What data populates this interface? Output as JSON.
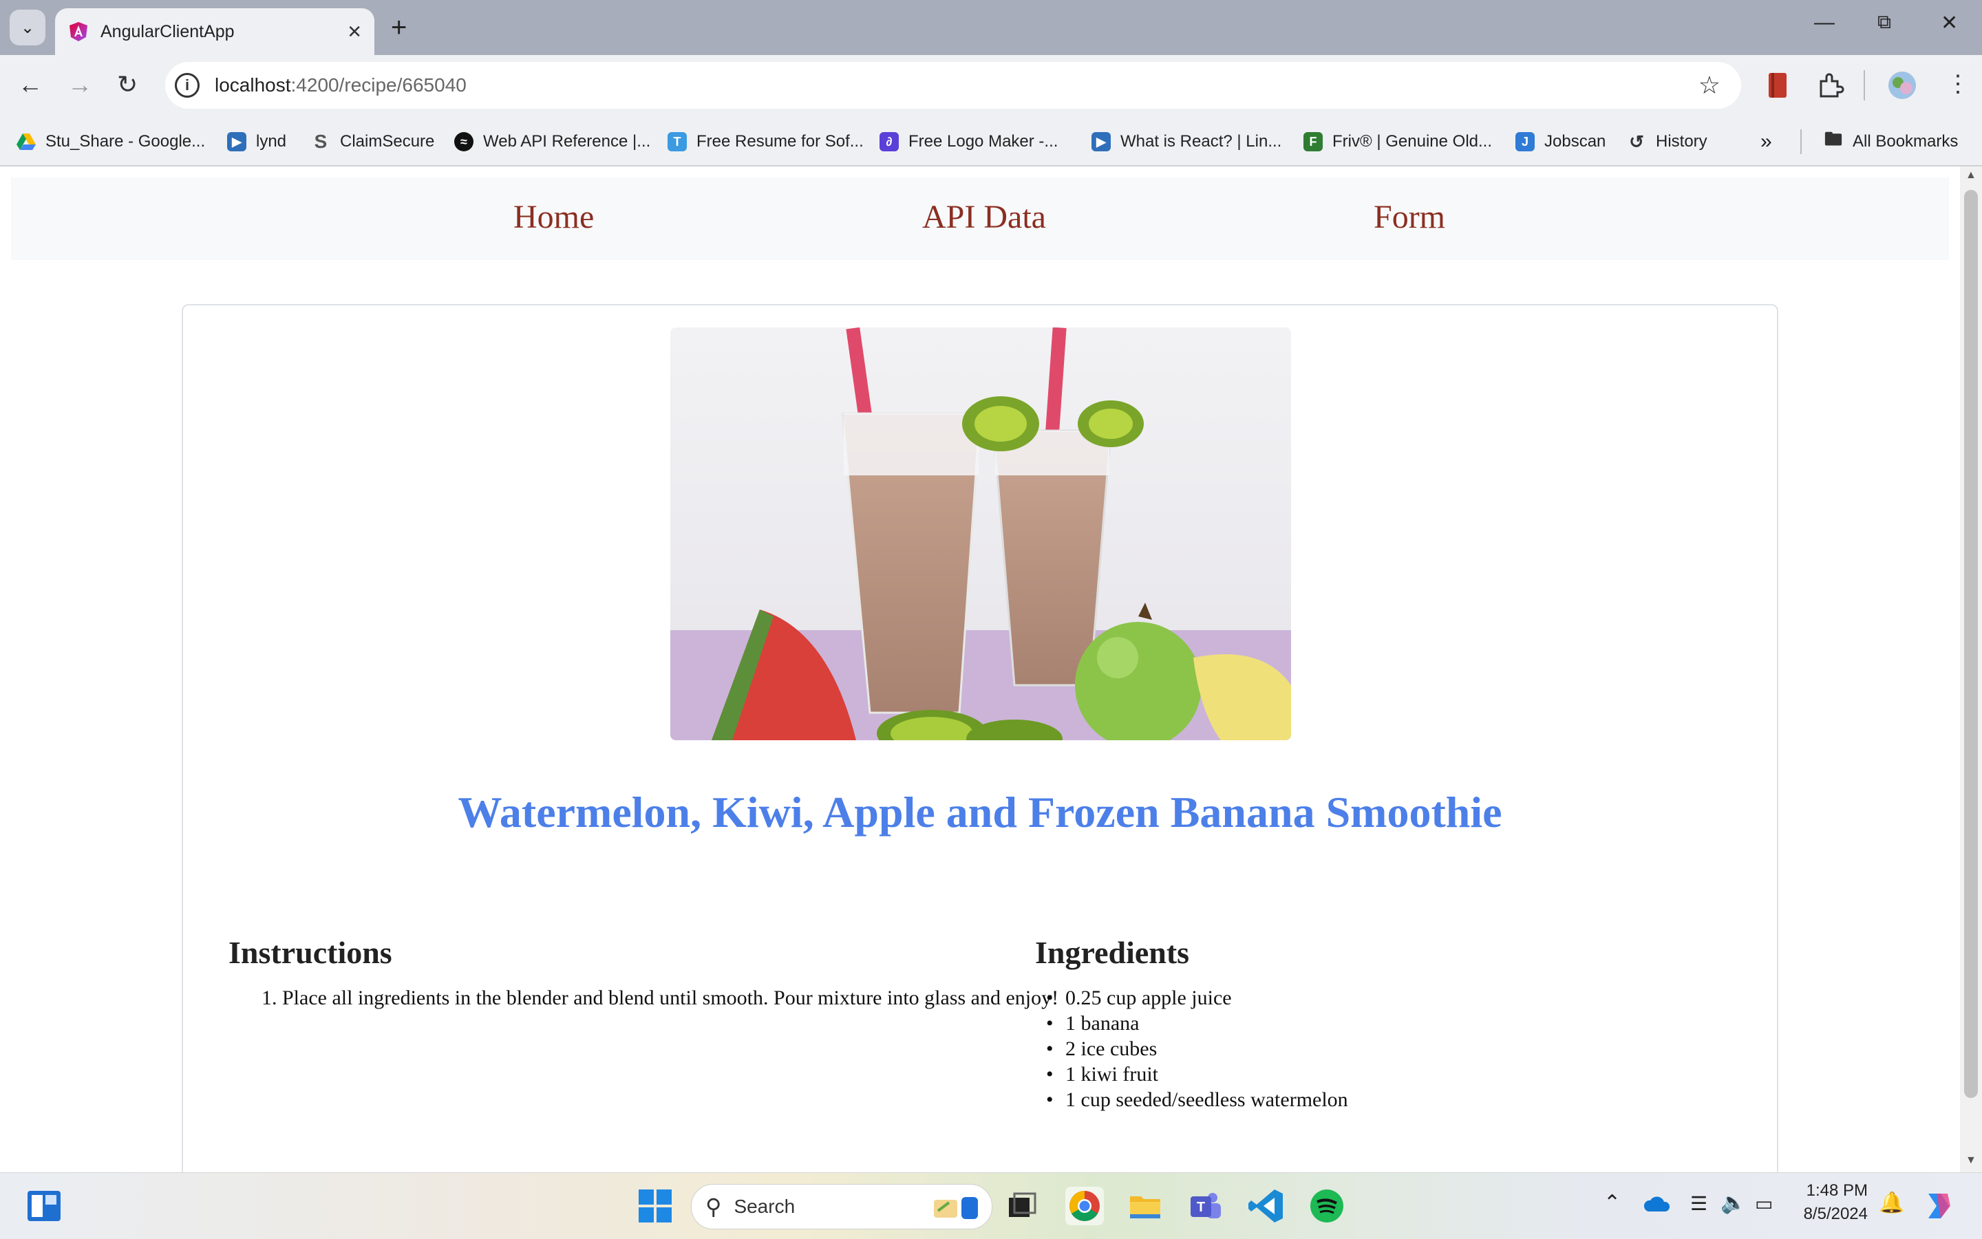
{
  "browser": {
    "tab_title": "AngularClientApp",
    "new_tab": "+",
    "url_host": "localhost",
    "url_path": ":4200/recipe/665040",
    "bookmarks": [
      {
        "label": "Stu_Share - Google...",
        "icon": "google-drive-icon",
        "color": "#1a73e8"
      },
      {
        "label": "lynd",
        "icon": "lynda-icon",
        "color": "#2f6fba"
      },
      {
        "label": "ClaimSecure",
        "icon": "claimsecure-icon",
        "color": "#555555"
      },
      {
        "label": "Web API Reference |...",
        "icon": "spotify-icon",
        "color": "#111111"
      },
      {
        "label": "Free Resume for Sof...",
        "icon": "resume-icon",
        "color": "#3b9ae1"
      },
      {
        "label": "Free Logo Maker -...",
        "icon": "logo-maker-icon",
        "color": "#5b3fd9"
      },
      {
        "label": "What is React? | Lin...",
        "icon": "linkedin-learning-icon",
        "color": "#2f6fba"
      },
      {
        "label": "Friv® | Genuine Old...",
        "icon": "friv-icon",
        "color": "#2e7d32"
      },
      {
        "label": "Jobscan",
        "icon": "jobscan-icon",
        "color": "#2f7bd6"
      },
      {
        "label": "History",
        "icon": "history-icon",
        "color": "#333333"
      }
    ],
    "bookmarks_overflow": "»",
    "all_bookmarks": "All Bookmarks"
  },
  "nav": {
    "home": "Home",
    "api_data": "API Data",
    "form": "Form"
  },
  "recipe": {
    "title": "Watermelon, Kiwi, Apple and Frozen Banana Smoothie",
    "instructions_heading": "Instructions",
    "instructions": [
      "Place all ingredients in the blender and blend until smooth. Pour mixture into glass and enjoy!"
    ],
    "ingredients_heading": "Ingredients",
    "ingredients": [
      "0.25 cup apple juice",
      "1 banana",
      "2 ice cubes",
      "1 kiwi fruit",
      "1 cup seeded/seedless watermelon"
    ]
  },
  "taskbar": {
    "search_label": "Search",
    "time": "1:48 PM",
    "date": "8/5/2024"
  },
  "colors": {
    "title_blue": "#4c7fe8",
    "nav_link": "#8b2e22"
  }
}
